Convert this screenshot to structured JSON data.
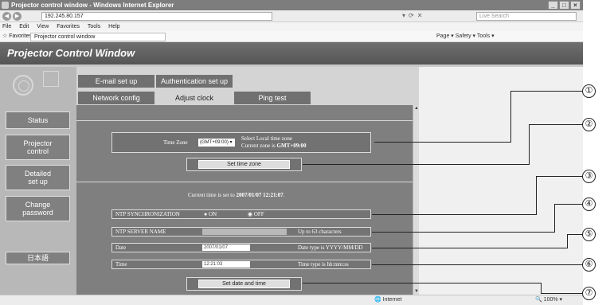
{
  "browser": {
    "title": "Projector control window - Windows Internet Explorer",
    "url": "192.245.80.157",
    "search_placeholder": "Live Search",
    "menu": [
      "File",
      "Edit",
      "View",
      "Favorites",
      "Tools",
      "Help"
    ],
    "favorites_label": "Favorites",
    "fav_tab": "Projector control window",
    "commands": "Page ▾  Safety ▾  Tools ▾",
    "status_zone": "Internet",
    "zoom": "100%"
  },
  "app": {
    "title": "Projector Control Window"
  },
  "nav": {
    "status": "Status",
    "projector_control": "Projector\ncontrol",
    "detailed_setup": "Detailed\nset up",
    "change_password": "Change\npassword",
    "language": "日本語"
  },
  "tabs": {
    "email": "E-mail set up",
    "auth": "Authentication set up",
    "network": "Network config",
    "adjust": "Adjust clock",
    "ping": "Ping test"
  },
  "clock": {
    "timezone_label": "Time Zone",
    "timezone_value": "(GMT+09:00)",
    "timezone_hint1": "Select Local time zone",
    "timezone_hint2_prefix": "Current zone is ",
    "timezone_hint2_value": "GMT+09:00",
    "set_timezone_button": "Set time zone",
    "current_time_prefix": "Current time is set to ",
    "current_time_value": "2007/01/07 12:21:07",
    "current_time_suffix": ".",
    "ntp_label": "NTP SYNCHRONIZATION",
    "ntp_on": "ON",
    "ntp_off": "OFF",
    "server_label": "NTP SERVER NAME",
    "server_hint": "Up to 63 characters",
    "date_label": "Date",
    "date_value": "2007/01/07",
    "date_hint": "Date type is YYYY/MM/DD",
    "time_label": "Time",
    "time_value": "12:21:03",
    "time_hint": "Time type is hh:mm:ss",
    "set_datetime_button": "Set date and time"
  },
  "callouts": [
    "①",
    "②",
    "③",
    "④",
    "⑤",
    "⑥",
    "⑦"
  ]
}
